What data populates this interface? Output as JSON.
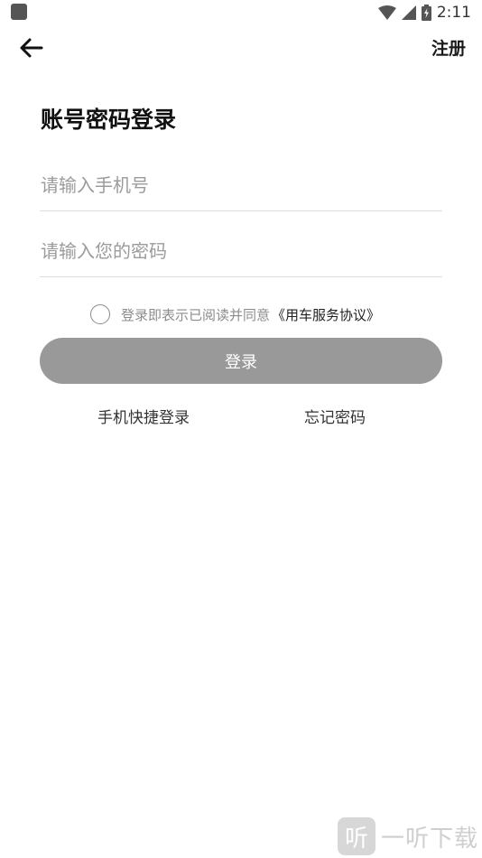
{
  "status_bar": {
    "time": "2:11"
  },
  "nav": {
    "register_label": "注册"
  },
  "title": "账号密码登录",
  "form": {
    "phone_placeholder": "请输入手机号",
    "password_placeholder": "请输入您的密码"
  },
  "agreement": {
    "text": "登录即表示已阅读并同意",
    "link": "《用车服务协议》"
  },
  "login_button": "登录",
  "links": {
    "quick_login": "手机快捷登录",
    "forgot_password": "忘记密码"
  },
  "watermark": {
    "badge": "听",
    "text": "一听下载"
  },
  "colors": {
    "button_disabled": "#999999",
    "placeholder": "#9b9b9b",
    "divider": "#dddddd"
  }
}
